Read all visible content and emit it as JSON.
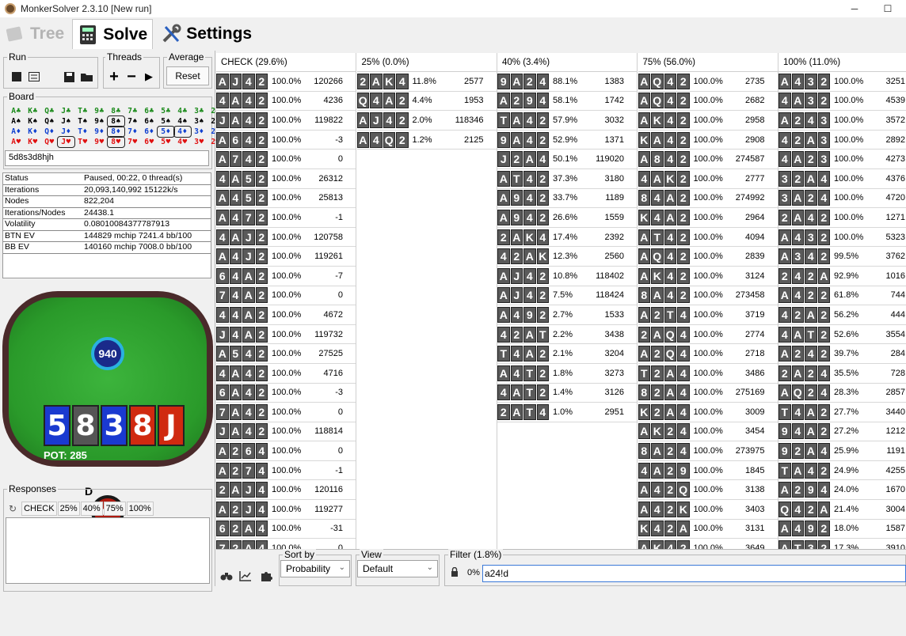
{
  "window": {
    "title": "MonkerSolver 2.3.10 [New run]",
    "minimize": "─",
    "maximize": "☐"
  },
  "tabs": [
    {
      "label": "Tree",
      "icon": "tree-icon"
    },
    {
      "label": "Solve",
      "icon": "calculator-icon"
    },
    {
      "label": "Settings",
      "icon": "tools-icon"
    }
  ],
  "run": {
    "label": "Run"
  },
  "threads": {
    "label": "Threads",
    "plus": "+",
    "minus": "−",
    "play": "▶"
  },
  "average": {
    "label": "Average",
    "reset": "Reset"
  },
  "board": {
    "label": "Board",
    "value": "5d8s3d8hjh",
    "rows": [
      {
        "suit": "cs",
        "cards": [
          "A♣",
          "K♣",
          "Q♣",
          "J♣",
          "T♣",
          "9♣",
          "8♣",
          "7♣",
          "6♣",
          "5♣",
          "4♣",
          "3♣",
          "2♣"
        ]
      },
      {
        "suit": "cc",
        "cards": [
          "A♠",
          "K♠",
          "Q♠",
          "J♠",
          "T♠",
          "9♠",
          "8♠",
          "7♠",
          "6♠",
          "5♠",
          "4♠",
          "3♠",
          "2♠"
        ]
      },
      {
        "suit": "cd",
        "cards": [
          "A♦",
          "K♦",
          "Q♦",
          "J♦",
          "T♦",
          "9♦",
          "8♦",
          "7♦",
          "6♦",
          "5♦",
          "4♦",
          "3♦",
          "2♦"
        ]
      },
      {
        "suit": "ch",
        "cards": [
          "A♥",
          "K♥",
          "Q♥",
          "J♥",
          "T♥",
          "9♥",
          "8♥",
          "7♥",
          "6♥",
          "5♥",
          "4♥",
          "3♥",
          "2♥"
        ]
      }
    ]
  },
  "stats": [
    {
      "k": "Status",
      "v": "Paused, 00:22, 0 thread(s)"
    },
    {
      "k": "Iterations",
      "v": "20,093,140,992  15122k/s"
    },
    {
      "k": "Nodes",
      "v": "822,204"
    },
    {
      "k": "Iterations/Nodes",
      "v": "24438.1"
    },
    {
      "k": "Volatility",
      "v": "0.08010084377787913"
    },
    {
      "k": "BTN EV",
      "v": "144829 mchip   7241.4 bb/100"
    },
    {
      "k": "BB EV",
      "v": "140160 mchip   7008.0 bb/100"
    }
  ],
  "table": {
    "top_chip": "940",
    "bottom_chip": "940",
    "pot": "POT: 285",
    "dealer": "D",
    "cards": [
      {
        "r": "5",
        "c": "#1a3ad0"
      },
      {
        "r": "8",
        "c": "#555555"
      },
      {
        "r": "3",
        "c": "#1a3ad0"
      },
      {
        "r": "8",
        "c": "#d02a10"
      },
      {
        "r": "J",
        "c": "#d02a10"
      }
    ]
  },
  "responses": {
    "label": "Responses",
    "refresh": "↻",
    "buttons": [
      "CHECK",
      "25%",
      "40%",
      "75%",
      "100%"
    ]
  },
  "columns": [
    {
      "header": "CHECK (29.6%)",
      "rows": [
        [
          "AJ42",
          "100.0%",
          "120266"
        ],
        [
          "4A42",
          "100.0%",
          "4236"
        ],
        [
          "JA42",
          "100.0%",
          "119822"
        ],
        [
          "A642",
          "100.0%",
          "-3"
        ],
        [
          "A742",
          "100.0%",
          "0"
        ],
        [
          "4A52",
          "100.0%",
          "26312"
        ],
        [
          "A452",
          "100.0%",
          "25813"
        ],
        [
          "A472",
          "100.0%",
          "-1"
        ],
        [
          "4AJ2",
          "100.0%",
          "120758"
        ],
        [
          "A4J2",
          "100.0%",
          "119261"
        ],
        [
          "64A2",
          "100.0%",
          "-7"
        ],
        [
          "74A2",
          "100.0%",
          "0"
        ],
        [
          "44A2",
          "100.0%",
          "4672"
        ],
        [
          "J4A2",
          "100.0%",
          "119732"
        ],
        [
          "A542",
          "100.0%",
          "27525"
        ],
        [
          "4A42",
          "100.0%",
          "4716"
        ],
        [
          "6A42",
          "100.0%",
          "-3"
        ],
        [
          "7A42",
          "100.0%",
          "0"
        ],
        [
          "JA42",
          "100.0%",
          "118814"
        ],
        [
          "A264",
          "100.0%",
          "0"
        ],
        [
          "A274",
          "100.0%",
          "-1"
        ],
        [
          "2AJ4",
          "100.0%",
          "120116"
        ],
        [
          "A2J4",
          "100.0%",
          "119277"
        ],
        [
          "62A4",
          "100.0%",
          "-31"
        ],
        [
          "72A4",
          "100.0%",
          "0"
        ]
      ]
    },
    {
      "header": "25% (0.0%)",
      "rows": [
        [
          "2AK4",
          "11.8%",
          "2577"
        ],
        [
          "Q4A2",
          "4.4%",
          "1953"
        ],
        [
          "AJ42",
          "2.0%",
          "118346"
        ],
        [
          "A4Q2",
          "1.2%",
          "2125"
        ]
      ]
    },
    {
      "header": "40% (3.4%)",
      "rows": [
        [
          "9A24",
          "88.1%",
          "1383"
        ],
        [
          "A294",
          "58.1%",
          "1742"
        ],
        [
          "TA42",
          "57.9%",
          "3032"
        ],
        [
          "9A42",
          "52.9%",
          "1371"
        ],
        [
          "J2A4",
          "50.1%",
          "119020"
        ],
        [
          "AT42",
          "37.3%",
          "3180"
        ],
        [
          "A942",
          "33.7%",
          "1189"
        ],
        [
          "A942",
          "26.6%",
          "1559"
        ],
        [
          "2AK4",
          "17.4%",
          "2392"
        ],
        [
          "42AK",
          "12.3%",
          "2560"
        ],
        [
          "AJ42",
          "10.8%",
          "118402"
        ],
        [
          "AJ42",
          "7.5%",
          "118424"
        ],
        [
          "A492",
          "2.7%",
          "1533"
        ],
        [
          "42AT",
          "2.2%",
          "3438"
        ],
        [
          "T4A2",
          "2.1%",
          "3204"
        ],
        [
          "A4T2",
          "1.8%",
          "3273"
        ],
        [
          "4AT2",
          "1.4%",
          "3126"
        ],
        [
          "2AT4",
          "1.0%",
          "2951"
        ]
      ]
    },
    {
      "header": "75% (56.0%)",
      "rows": [
        [
          "AQ42",
          "100.0%",
          "2735"
        ],
        [
          "AQ42",
          "100.0%",
          "2682"
        ],
        [
          "AK42",
          "100.0%",
          "2958"
        ],
        [
          "KA42",
          "100.0%",
          "2908"
        ],
        [
          "A842",
          "100.0%",
          "274587"
        ],
        [
          "4AK2",
          "100.0%",
          "2777"
        ],
        [
          "84A2",
          "100.0%",
          "274992"
        ],
        [
          "K4A2",
          "100.0%",
          "2964"
        ],
        [
          "AT42",
          "100.0%",
          "4094"
        ],
        [
          "AQ42",
          "100.0%",
          "2839"
        ],
        [
          "AK42",
          "100.0%",
          "3124"
        ],
        [
          "8A42",
          "100.0%",
          "273458"
        ],
        [
          "A2T4",
          "100.0%",
          "3719"
        ],
        [
          "2AQ4",
          "100.0%",
          "2774"
        ],
        [
          "A2Q4",
          "100.0%",
          "2718"
        ],
        [
          "T2A4",
          "100.0%",
          "3486"
        ],
        [
          "82A4",
          "100.0%",
          "275169"
        ],
        [
          "K2A4",
          "100.0%",
          "3009"
        ],
        [
          "AK24",
          "100.0%",
          "3454"
        ],
        [
          "8A24",
          "100.0%",
          "273975"
        ],
        [
          "4A29",
          "100.0%",
          "1845"
        ],
        [
          "A42Q",
          "100.0%",
          "3138"
        ],
        [
          "A42K",
          "100.0%",
          "3403"
        ],
        [
          "K42A",
          "100.0%",
          "3131"
        ],
        [
          "AK42",
          "100.0%",
          "3649"
        ]
      ]
    },
    {
      "header": "100% (11.0%)",
      "rows": [
        [
          "A432",
          "100.0%",
          "3251"
        ],
        [
          "4A32",
          "100.0%",
          "4539"
        ],
        [
          "A243",
          "100.0%",
          "3572"
        ],
        [
          "42A3",
          "100.0%",
          "2892"
        ],
        [
          "4A23",
          "100.0%",
          "4273"
        ],
        [
          "32A4",
          "100.0%",
          "4376"
        ],
        [
          "3A24",
          "100.0%",
          "4720"
        ],
        [
          "2A42",
          "100.0%",
          "1271"
        ],
        [
          "A432",
          "100.0%",
          "5323"
        ],
        [
          "A342",
          "99.5%",
          "3762"
        ],
        [
          "242A",
          "92.9%",
          "1016"
        ],
        [
          "A422",
          "61.8%",
          "744"
        ],
        [
          "42A2",
          "56.2%",
          "444"
        ],
        [
          "4AT2",
          "52.6%",
          "3554"
        ],
        [
          "A242",
          "39.7%",
          "284"
        ],
        [
          "2A24",
          "35.5%",
          "728"
        ],
        [
          "AQ24",
          "28.3%",
          "2857"
        ],
        [
          "T4A2",
          "27.7%",
          "3440"
        ],
        [
          "94A2",
          "27.2%",
          "1212"
        ],
        [
          "92A4",
          "25.9%",
          "1191"
        ],
        [
          "TA42",
          "24.9%",
          "4255"
        ],
        [
          "A294",
          "24.0%",
          "1670"
        ],
        [
          "Q42A",
          "21.4%",
          "3004"
        ],
        [
          "A492",
          "18.0%",
          "1587"
        ],
        [
          "AT32",
          "17.3%",
          "3910"
        ]
      ]
    }
  ],
  "bottom": {
    "sort": {
      "label": "Sort by",
      "value": "Probability"
    },
    "view": {
      "label": "View",
      "value": "Default"
    },
    "filter": {
      "label": "Filter (1.8%)",
      "percent": "0%",
      "value": "a24!d"
    }
  }
}
